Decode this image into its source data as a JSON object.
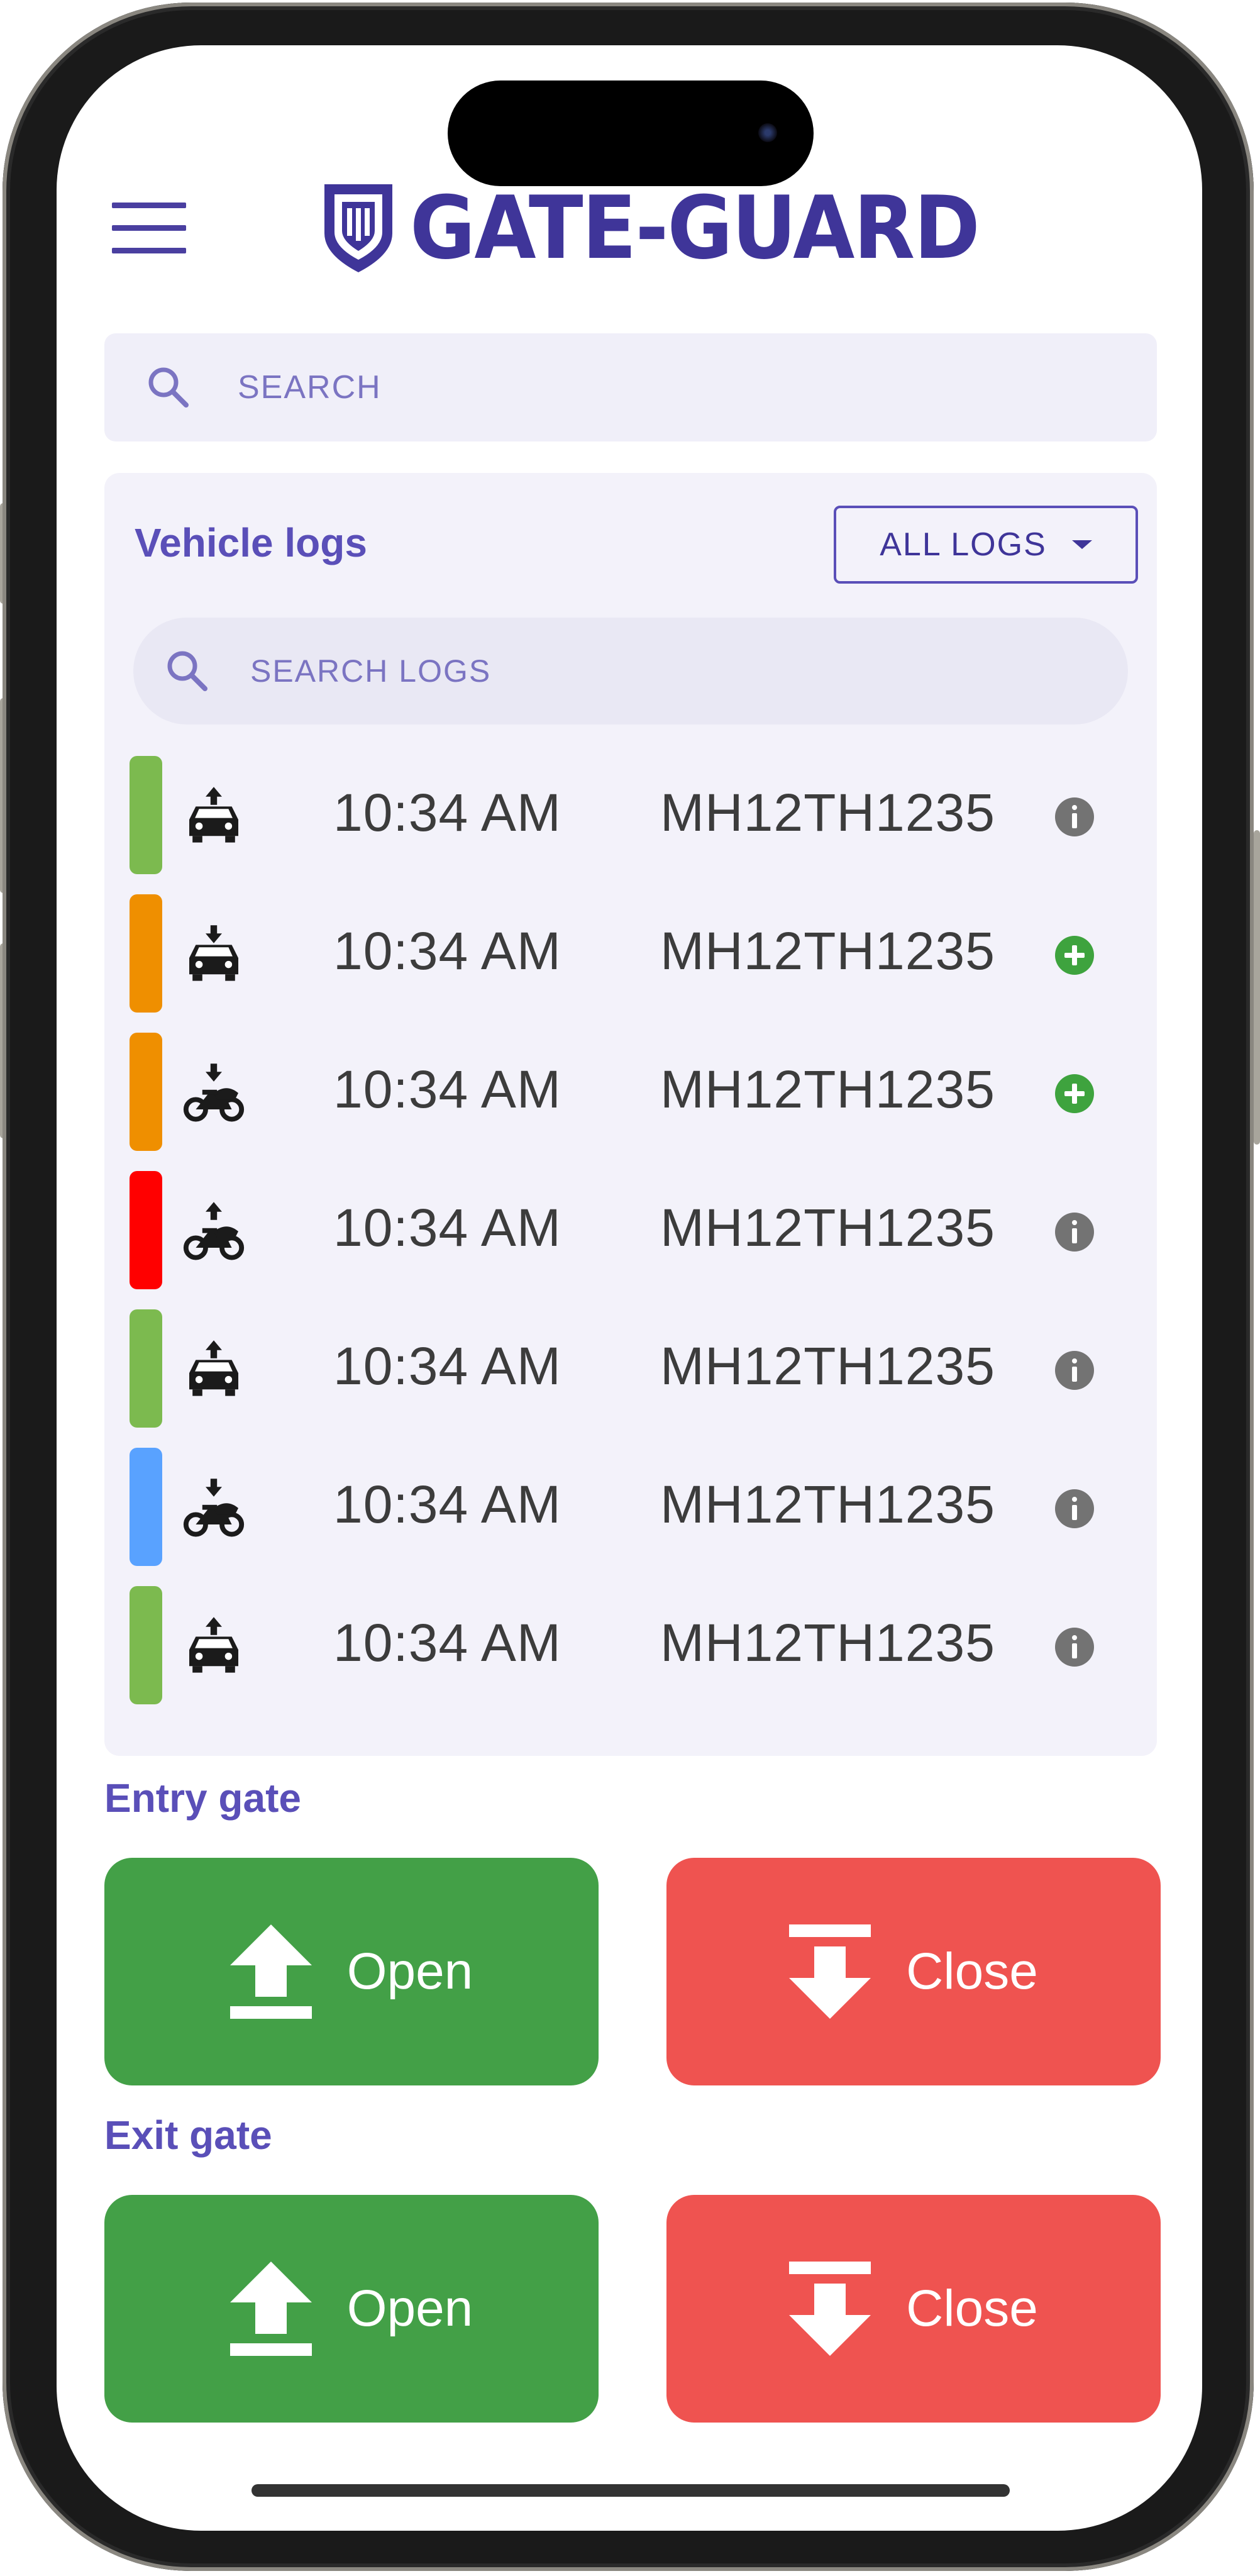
{
  "app": {
    "brand": "GATE-GUARD",
    "colors": {
      "primary": "#3f3599",
      "accent": "#5a4fb8",
      "open": "#43a047",
      "close": "#ef5350",
      "entry_out": "#7cba4f",
      "entry_in": "#ef8f00",
      "alert": "#ff0000",
      "other": "#59a2ff"
    }
  },
  "search": {
    "placeholder": "SEARCH"
  },
  "vehicle_logs": {
    "title": "Vehicle logs",
    "filter_label": "ALL LOGS",
    "search_placeholder": "SEARCH LOGS",
    "rows": [
      {
        "vehicle_icon": "car-exit-icon",
        "time": "10:34 AM",
        "plate": "MH12TH1235",
        "action_icon": "info-icon",
        "status_color": "#7cba4f"
      },
      {
        "vehicle_icon": "car-entry-icon",
        "time": "10:34 AM",
        "plate": "MH12TH1235",
        "action_icon": "add-icon",
        "status_color": "#ef8f00"
      },
      {
        "vehicle_icon": "bike-entry-icon",
        "time": "10:34 AM",
        "plate": "MH12TH1235",
        "action_icon": "add-icon",
        "status_color": "#ef8f00"
      },
      {
        "vehicle_icon": "bike-exit-icon",
        "time": "10:34 AM",
        "plate": "MH12TH1235",
        "action_icon": "info-icon",
        "status_color": "#ff0000"
      },
      {
        "vehicle_icon": "car-exit-icon",
        "time": "10:34 AM",
        "plate": "MH12TH1235",
        "action_icon": "info-icon",
        "status_color": "#7cba4f"
      },
      {
        "vehicle_icon": "bike-entry-icon",
        "time": "10:34 AM",
        "plate": "MH12TH1235",
        "action_icon": "info-icon",
        "status_color": "#59a2ff"
      },
      {
        "vehicle_icon": "car-exit-icon",
        "time": "10:34 AM",
        "plate": "MH12TH1235",
        "action_icon": "info-icon",
        "status_color": "#7cba4f"
      }
    ]
  },
  "entry_gate": {
    "label": "Entry gate",
    "open_label": "Open",
    "close_label": "Close"
  },
  "exit_gate": {
    "label": "Exit gate",
    "open_label": "Open",
    "close_label": "Close"
  }
}
